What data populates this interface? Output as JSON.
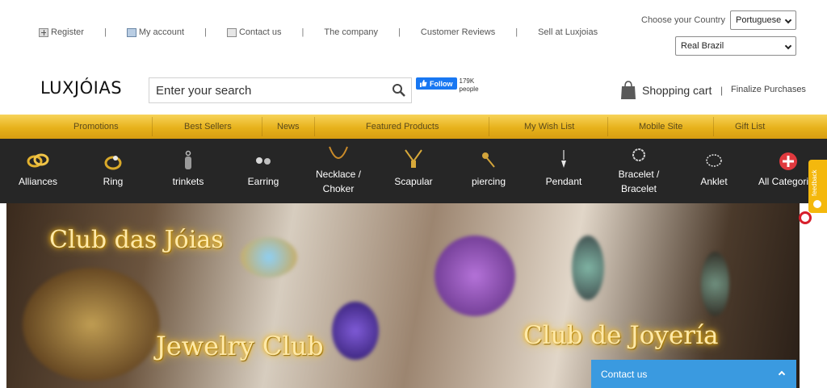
{
  "toplinks": {
    "register": "Register",
    "account": "My account",
    "contact": "Contact us",
    "company": "The company",
    "reviews": "Customer Reviews",
    "sell": "Sell at Luxjoias",
    "separator": "|"
  },
  "country": {
    "label": "Choose your Country",
    "language": "Portuguese",
    "currency": "Real Brazil"
  },
  "header": {
    "logo": "LUXJÓIAS",
    "search_placeholder": "Enter your search",
    "fb_follow": "Follow",
    "fb_count": "179K people",
    "cart": "Shopping cart",
    "divider": "|",
    "finalize": "Finalize Purchases"
  },
  "goldnav": [
    "Promotions",
    "Best Sellers",
    "News",
    "Featured Products",
    "My Wish List",
    "Mobile Site",
    "Gift List"
  ],
  "categories": [
    {
      "label": "Alliances",
      "icon": "alliances-icon"
    },
    {
      "label": "Ring",
      "icon": "ring-icon"
    },
    {
      "label": "trinkets",
      "icon": "trinkets-icon"
    },
    {
      "label": "Earring",
      "icon": "earring-icon"
    },
    {
      "label": "Necklace / Choker",
      "icon": "necklace-icon"
    },
    {
      "label": "Scapular",
      "icon": "scapular-icon"
    },
    {
      "label": "piercing",
      "icon": "piercing-icon"
    },
    {
      "label": "Pendant",
      "icon": "pendant-icon"
    },
    {
      "label": "Bracelet / Bracelet",
      "icon": "bracelet-icon"
    },
    {
      "label": "Anklet",
      "icon": "anklet-icon"
    },
    {
      "label": "All Categories",
      "icon": "plus-icon"
    }
  ],
  "banner": {
    "text_pt": "Club das Jóias",
    "text_en": "Jewelry Club",
    "text_es": "Club de Joyería"
  },
  "widgets": {
    "feedback": "feedback",
    "contact": "Contact us"
  },
  "colors": {
    "gold": "#e7b21b",
    "dark_bar": "#262626",
    "contact_blue": "#3a9ae0",
    "fb_blue": "#1877f2",
    "red_plus": "#e0393e"
  }
}
